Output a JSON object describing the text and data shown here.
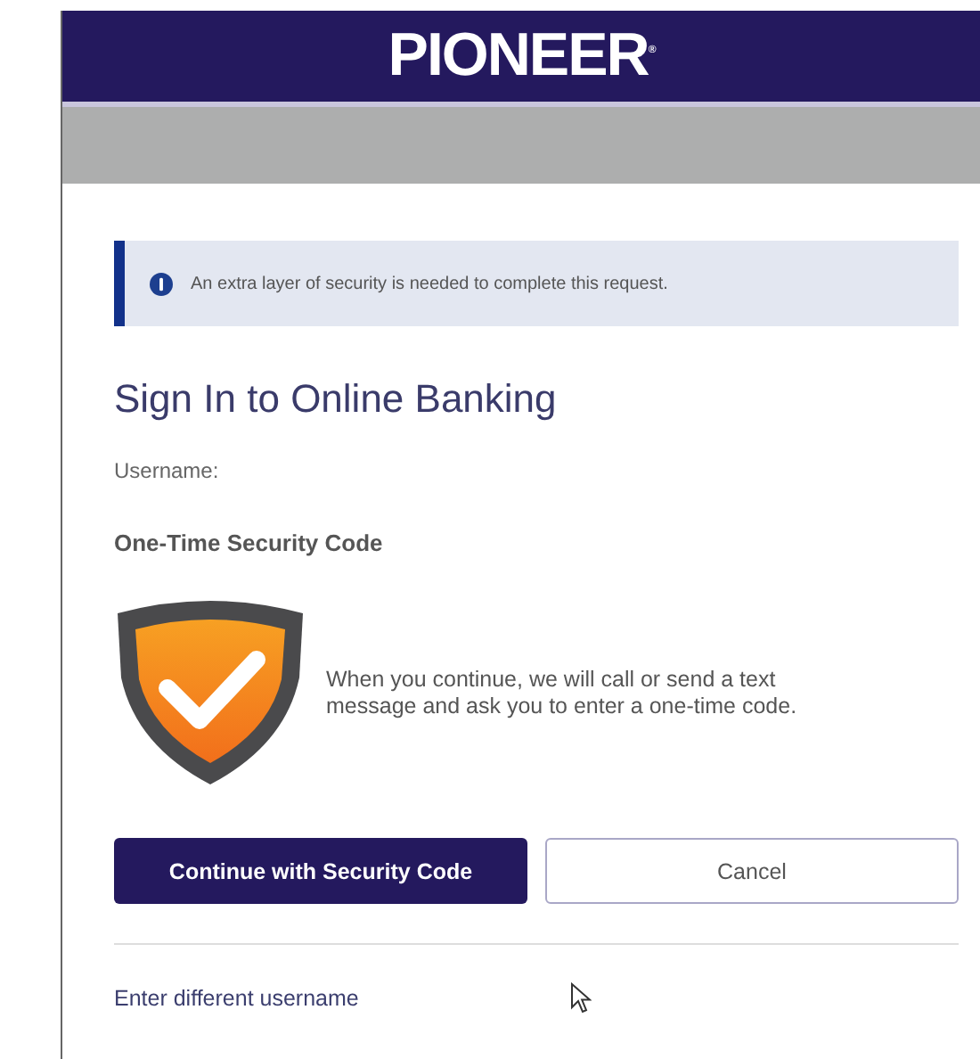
{
  "header": {
    "brand": "PIONEER$^{®}$"
  },
  "alert": {
    "text": "An extra layer of security is needed to complete this request."
  },
  "title": "Sign In to Online Banking",
  "username_label": "Username:",
  "section_heading": "One-Time Security Code",
  "info_text": "When you continue, we will call or send a text message and ask you to enter a one-time code.",
  "buttons": [
    {
      "label": "Continue with Security Code",
      "kind": "primary"
    },
    {
      "label": "Cancel",
      "kind": "secondary"
    }
  ],
  "link": "Enter different username"
}
